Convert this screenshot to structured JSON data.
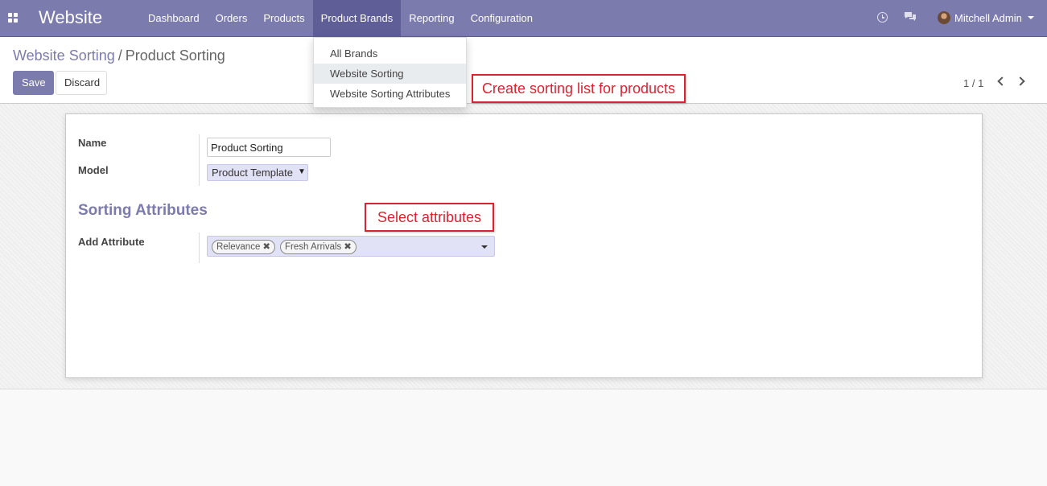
{
  "navbar": {
    "brand": "Website",
    "menu": [
      "Dashboard",
      "Orders",
      "Products",
      "Product Brands",
      "Reporting",
      "Configuration"
    ],
    "active_menu": "Product Brands",
    "user_name": "Mitchell Admin",
    "accent_color": "#7c7bad"
  },
  "dropdown": {
    "items": [
      "All Brands",
      "Website Sorting",
      "Website Sorting Attributes"
    ],
    "hovered": "Website Sorting"
  },
  "breadcrumb": {
    "parent": "Website Sorting",
    "separator": "/",
    "current": "Product Sorting"
  },
  "buttons": {
    "save": "Save",
    "discard": "Discard"
  },
  "pager": {
    "value": "1 / 1"
  },
  "form": {
    "name_label": "Name",
    "name_value": "Product Sorting",
    "model_label": "Model",
    "model_value": "Product Template",
    "section_title": "Sorting Attributes",
    "attribute_label": "Add Attribute",
    "attributes": [
      "Relevance",
      "Fresh Arrivals"
    ]
  },
  "annotations": {
    "sorting_list": "Create sorting list for products",
    "select_attributes": "Select attributes",
    "color": "#d9232f"
  }
}
